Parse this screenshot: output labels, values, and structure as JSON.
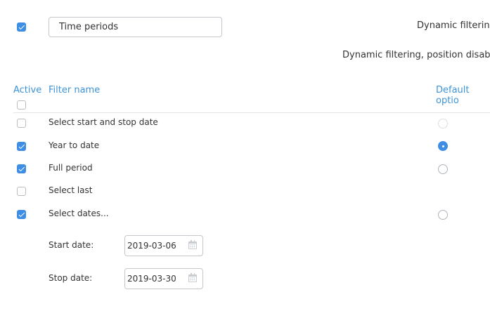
{
  "header": {
    "enabled": true,
    "filter_title_value": "Time periods",
    "dynamic_filtering_label": "Dynamic filtering",
    "dynamic_filtering_position_disabled_label": "Dynamic filtering, position disabled"
  },
  "table": {
    "columns": {
      "active": "Active",
      "filter_name": "Filter name",
      "default_option": "Default optio"
    },
    "select_all_checked": false,
    "rows": [
      {
        "label": "Select start and stop date",
        "active": false,
        "default": "disabled"
      },
      {
        "label": "Year to date",
        "active": true,
        "default": "selected"
      },
      {
        "label": "Full period",
        "active": true,
        "default": "unselected"
      },
      {
        "label": "Select last",
        "active": false,
        "default": "none"
      },
      {
        "label": "Select dates...",
        "active": true,
        "default": "unselected"
      }
    ]
  },
  "dates": {
    "start_label": "Start date:",
    "start_value": "2019-03-06",
    "stop_label": "Stop date:",
    "stop_value": "2019-03-30"
  },
  "colors": {
    "accent": "#3e8ee6",
    "header_text": "#3d93d9"
  }
}
